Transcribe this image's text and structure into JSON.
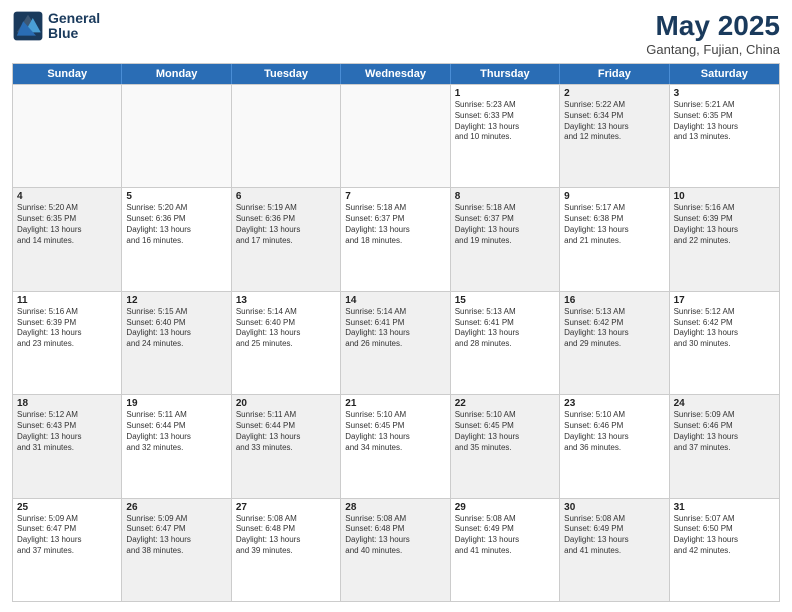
{
  "header": {
    "logo_line1": "General",
    "logo_line2": "Blue",
    "month": "May 2025",
    "location": "Gantang, Fujian, China"
  },
  "days_of_week": [
    "Sunday",
    "Monday",
    "Tuesday",
    "Wednesday",
    "Thursday",
    "Friday",
    "Saturday"
  ],
  "weeks": [
    [
      {
        "num": "",
        "info": "",
        "empty": true
      },
      {
        "num": "",
        "info": "",
        "empty": true
      },
      {
        "num": "",
        "info": "",
        "empty": true
      },
      {
        "num": "",
        "info": "",
        "empty": true
      },
      {
        "num": "1",
        "info": "Sunrise: 5:23 AM\nSunset: 6:33 PM\nDaylight: 13 hours\nand 10 minutes."
      },
      {
        "num": "2",
        "info": "Sunrise: 5:22 AM\nSunset: 6:34 PM\nDaylight: 13 hours\nand 12 minutes.",
        "shaded": true
      },
      {
        "num": "3",
        "info": "Sunrise: 5:21 AM\nSunset: 6:35 PM\nDaylight: 13 hours\nand 13 minutes."
      }
    ],
    [
      {
        "num": "4",
        "info": "Sunrise: 5:20 AM\nSunset: 6:35 PM\nDaylight: 13 hours\nand 14 minutes.",
        "shaded": true
      },
      {
        "num": "5",
        "info": "Sunrise: 5:20 AM\nSunset: 6:36 PM\nDaylight: 13 hours\nand 16 minutes."
      },
      {
        "num": "6",
        "info": "Sunrise: 5:19 AM\nSunset: 6:36 PM\nDaylight: 13 hours\nand 17 minutes.",
        "shaded": true
      },
      {
        "num": "7",
        "info": "Sunrise: 5:18 AM\nSunset: 6:37 PM\nDaylight: 13 hours\nand 18 minutes."
      },
      {
        "num": "8",
        "info": "Sunrise: 5:18 AM\nSunset: 6:37 PM\nDaylight: 13 hours\nand 19 minutes.",
        "shaded": true
      },
      {
        "num": "9",
        "info": "Sunrise: 5:17 AM\nSunset: 6:38 PM\nDaylight: 13 hours\nand 21 minutes."
      },
      {
        "num": "10",
        "info": "Sunrise: 5:16 AM\nSunset: 6:39 PM\nDaylight: 13 hours\nand 22 minutes.",
        "shaded": true
      }
    ],
    [
      {
        "num": "11",
        "info": "Sunrise: 5:16 AM\nSunset: 6:39 PM\nDaylight: 13 hours\nand 23 minutes."
      },
      {
        "num": "12",
        "info": "Sunrise: 5:15 AM\nSunset: 6:40 PM\nDaylight: 13 hours\nand 24 minutes.",
        "shaded": true
      },
      {
        "num": "13",
        "info": "Sunrise: 5:14 AM\nSunset: 6:40 PM\nDaylight: 13 hours\nand 25 minutes."
      },
      {
        "num": "14",
        "info": "Sunrise: 5:14 AM\nSunset: 6:41 PM\nDaylight: 13 hours\nand 26 minutes.",
        "shaded": true
      },
      {
        "num": "15",
        "info": "Sunrise: 5:13 AM\nSunset: 6:41 PM\nDaylight: 13 hours\nand 28 minutes."
      },
      {
        "num": "16",
        "info": "Sunrise: 5:13 AM\nSunset: 6:42 PM\nDaylight: 13 hours\nand 29 minutes.",
        "shaded": true
      },
      {
        "num": "17",
        "info": "Sunrise: 5:12 AM\nSunset: 6:42 PM\nDaylight: 13 hours\nand 30 minutes."
      }
    ],
    [
      {
        "num": "18",
        "info": "Sunrise: 5:12 AM\nSunset: 6:43 PM\nDaylight: 13 hours\nand 31 minutes.",
        "shaded": true
      },
      {
        "num": "19",
        "info": "Sunrise: 5:11 AM\nSunset: 6:44 PM\nDaylight: 13 hours\nand 32 minutes."
      },
      {
        "num": "20",
        "info": "Sunrise: 5:11 AM\nSunset: 6:44 PM\nDaylight: 13 hours\nand 33 minutes.",
        "shaded": true
      },
      {
        "num": "21",
        "info": "Sunrise: 5:10 AM\nSunset: 6:45 PM\nDaylight: 13 hours\nand 34 minutes."
      },
      {
        "num": "22",
        "info": "Sunrise: 5:10 AM\nSunset: 6:45 PM\nDaylight: 13 hours\nand 35 minutes.",
        "shaded": true
      },
      {
        "num": "23",
        "info": "Sunrise: 5:10 AM\nSunset: 6:46 PM\nDaylight: 13 hours\nand 36 minutes."
      },
      {
        "num": "24",
        "info": "Sunrise: 5:09 AM\nSunset: 6:46 PM\nDaylight: 13 hours\nand 37 minutes.",
        "shaded": true
      }
    ],
    [
      {
        "num": "25",
        "info": "Sunrise: 5:09 AM\nSunset: 6:47 PM\nDaylight: 13 hours\nand 37 minutes."
      },
      {
        "num": "26",
        "info": "Sunrise: 5:09 AM\nSunset: 6:47 PM\nDaylight: 13 hours\nand 38 minutes.",
        "shaded": true
      },
      {
        "num": "27",
        "info": "Sunrise: 5:08 AM\nSunset: 6:48 PM\nDaylight: 13 hours\nand 39 minutes."
      },
      {
        "num": "28",
        "info": "Sunrise: 5:08 AM\nSunset: 6:48 PM\nDaylight: 13 hours\nand 40 minutes.",
        "shaded": true
      },
      {
        "num": "29",
        "info": "Sunrise: 5:08 AM\nSunset: 6:49 PM\nDaylight: 13 hours\nand 41 minutes."
      },
      {
        "num": "30",
        "info": "Sunrise: 5:08 AM\nSunset: 6:49 PM\nDaylight: 13 hours\nand 41 minutes.",
        "shaded": true
      },
      {
        "num": "31",
        "info": "Sunrise: 5:07 AM\nSunset: 6:50 PM\nDaylight: 13 hours\nand 42 minutes."
      }
    ]
  ]
}
